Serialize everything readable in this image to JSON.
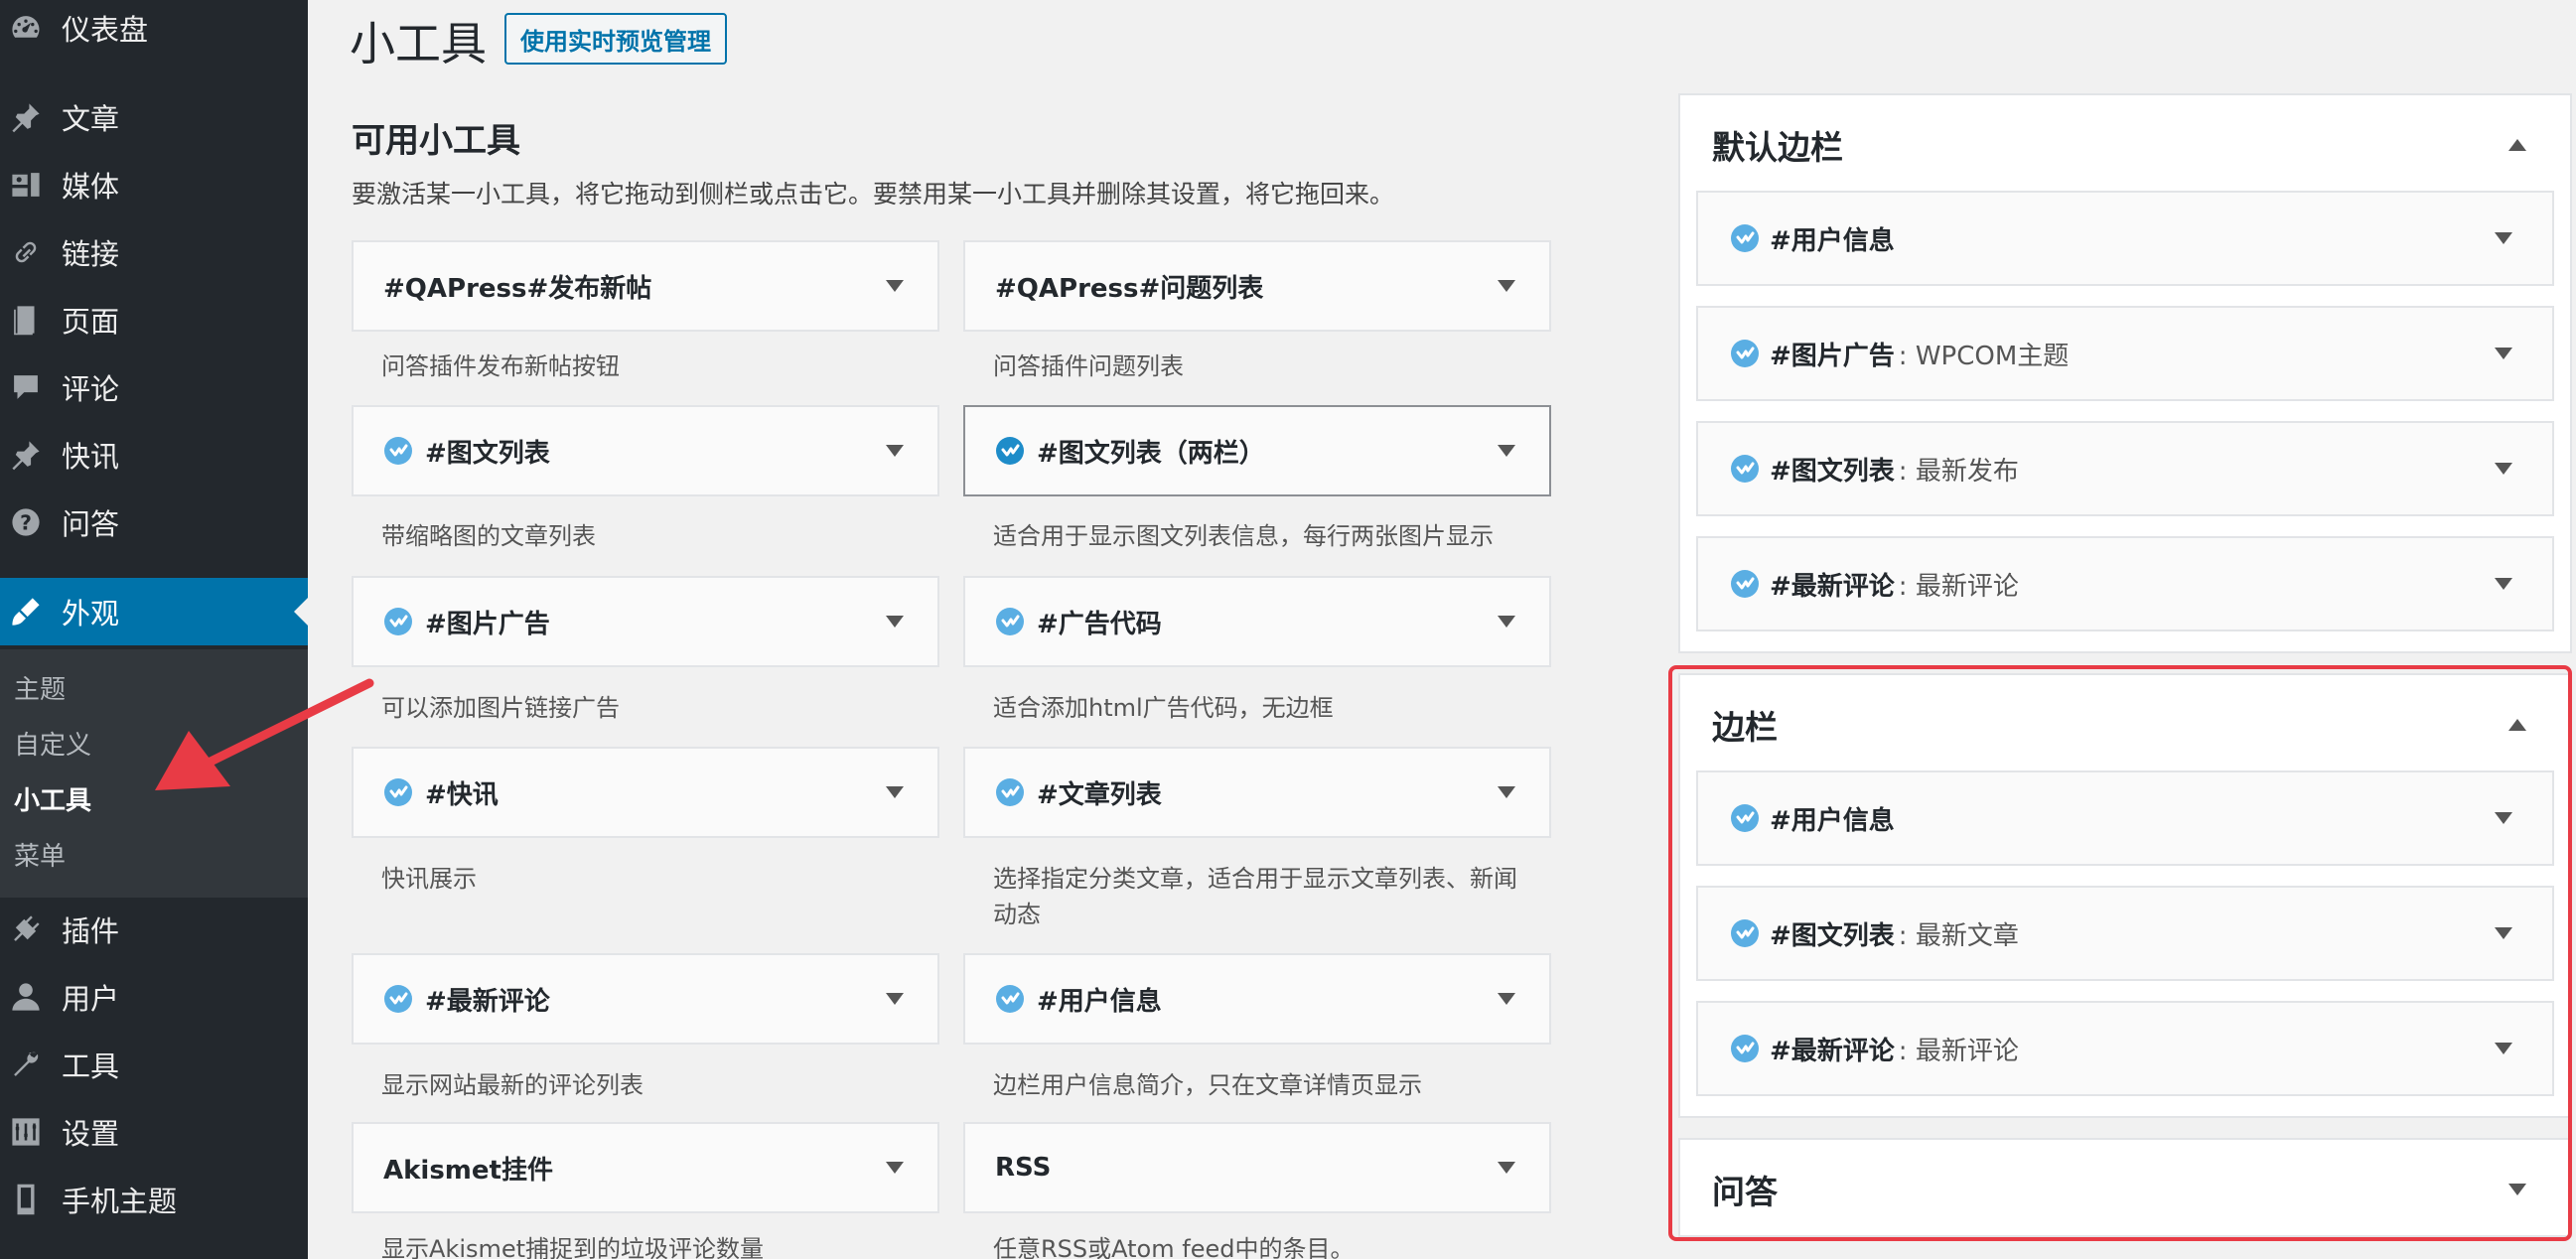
{
  "sidebar": {
    "items": [
      {
        "label": "仪表盘",
        "icon": "dashboard-icon"
      },
      {
        "label": "文章",
        "icon": "pin-icon"
      },
      {
        "label": "媒体",
        "icon": "media-icon"
      },
      {
        "label": "链接",
        "icon": "link-icon"
      },
      {
        "label": "页面",
        "icon": "page-icon"
      },
      {
        "label": "评论",
        "icon": "comment-icon"
      },
      {
        "label": "快讯",
        "icon": "pin-icon"
      },
      {
        "label": "问答",
        "icon": "help-icon"
      },
      {
        "label": "外观",
        "icon": "brush-icon"
      },
      {
        "label": "插件",
        "icon": "plugin-icon"
      },
      {
        "label": "用户",
        "icon": "user-icon"
      },
      {
        "label": "工具",
        "icon": "wrench-icon"
      },
      {
        "label": "设置",
        "icon": "settings-icon"
      },
      {
        "label": "手机主题",
        "icon": "mobile-icon"
      }
    ],
    "submenu": [
      "主题",
      "自定义",
      "小工具",
      "菜单"
    ]
  },
  "header": {
    "title": "小工具",
    "live_preview_button": "使用实时预览管理"
  },
  "available": {
    "title": "可用小工具",
    "description": "要激活某一小工具，将它拖动到侧栏或点击它。要禁用某一小工具并删除其设置，将它拖回来。",
    "widgets": [
      {
        "title": "#QAPress#发布新帖",
        "desc": "问答插件发布新帖按钮",
        "icon": false
      },
      {
        "title": "#QAPress#问题列表",
        "desc": "问答插件问题列表",
        "icon": false
      },
      {
        "title": "#图文列表",
        "desc": "带缩略图的文章列表",
        "icon": true
      },
      {
        "title": "#图文列表（两栏）",
        "desc": "适合用于显示图文列表信息，每行两张图片显示",
        "icon": true
      },
      {
        "title": "#图片广告",
        "desc": "可以添加图片链接广告",
        "icon": true
      },
      {
        "title": "#广告代码",
        "desc": "适合添加html广告代码，无边框",
        "icon": true
      },
      {
        "title": "#快讯",
        "desc": "快讯展示",
        "icon": true
      },
      {
        "title": "#文章列表",
        "desc": "选择指定分类文章，适合用于显示文章列表、新闻动态",
        "icon": true
      },
      {
        "title": "#最新评论",
        "desc": "显示网站最新的评论列表",
        "icon": true
      },
      {
        "title": "#用户信息",
        "desc": "边栏用户信息简介，只在文章详情页显示",
        "icon": true
      },
      {
        "title": "Akismet挂件",
        "desc": "显示Akismet捕捉到的垃圾评论数量",
        "icon": false
      },
      {
        "title": "RSS",
        "desc": "任意RSS或Atom feed中的条目。",
        "icon": false
      }
    ]
  },
  "sidebars": [
    {
      "name": "默认边栏",
      "widgets": [
        {
          "title": "#用户信息",
          "sub": ""
        },
        {
          "title": "#图片广告",
          "sub": ": WPCOM主题"
        },
        {
          "title": "#图文列表",
          "sub": ": 最新发布"
        },
        {
          "title": "#最新评论",
          "sub": ": 最新评论"
        }
      ]
    },
    {
      "name": "边栏",
      "widgets": [
        {
          "title": "#用户信息",
          "sub": ""
        },
        {
          "title": "#图文列表",
          "sub": ": 最新文章"
        },
        {
          "title": "#最新评论",
          "sub": ": 最新评论"
        }
      ]
    },
    {
      "name": "问答",
      "widgets": []
    }
  ],
  "colors": {
    "accent": "#0073aa",
    "sidebar_bg": "#23282d",
    "highlight_box": "#e83b45",
    "wpcom_icon": "#5aaee3"
  }
}
